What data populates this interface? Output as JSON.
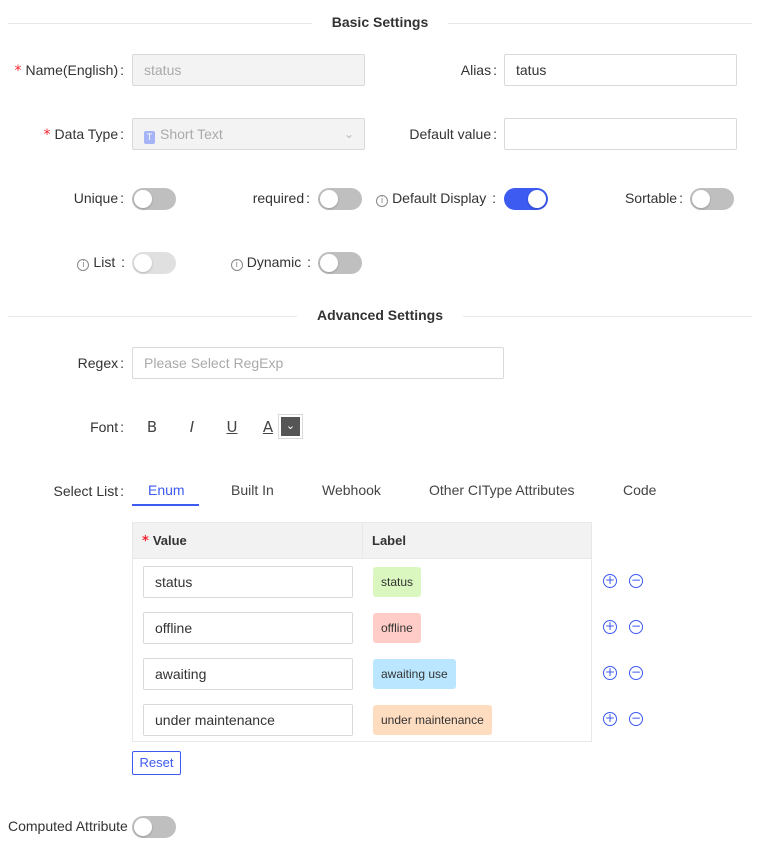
{
  "sections": {
    "basic": "Basic Settings",
    "advanced": "Advanced Settings"
  },
  "fields": {
    "name_label": "Name(English)",
    "name_value": "status",
    "alias_label": "Alias",
    "alias_value": "tatus",
    "data_type_label": "Data Type",
    "data_type_value": "Short Text",
    "default_value_label": "Default value",
    "default_value": ""
  },
  "toggles": {
    "unique": {
      "label": "Unique",
      "on": false
    },
    "required": {
      "label": "required",
      "on": false
    },
    "default_display": {
      "label": "Default Display",
      "on": true
    },
    "sortable": {
      "label": "Sortable",
      "on": false
    },
    "list": {
      "label": "List",
      "on": false,
      "disabled": true
    },
    "dynamic": {
      "label": "Dynamic",
      "on": false
    }
  },
  "advanced": {
    "regex_label": "Regex",
    "regex_placeholder": "Please Select RegExp",
    "font_label": "Font",
    "font_buttons": {
      "bold": "B",
      "italic": "I",
      "underline": "U",
      "color": "A"
    },
    "select_list_label": "Select List",
    "tabs": [
      "Enum",
      "Built In",
      "Webhook",
      "Other CIType Attributes",
      "Code"
    ],
    "active_tab": "Enum"
  },
  "enum_table": {
    "value_header": "Value",
    "label_header": "Label",
    "rows": [
      {
        "value": "status",
        "label": "status",
        "color": "#d9f7be"
      },
      {
        "value": "offline",
        "label": "offline",
        "color": "#ffccc7"
      },
      {
        "value": "awaiting",
        "label": "awaiting use",
        "color": "#bae7ff"
      },
      {
        "value": "under maintenance",
        "label": "under maintenance",
        "color": "#fddcc0"
      }
    ],
    "add_icon": "plus-circle-icon",
    "remove_icon": "minus-circle-icon"
  },
  "reset_label": "Reset",
  "computed": {
    "label": "Computed Attribute",
    "on": false
  },
  "colors": {
    "accent": "#3d5af1"
  }
}
